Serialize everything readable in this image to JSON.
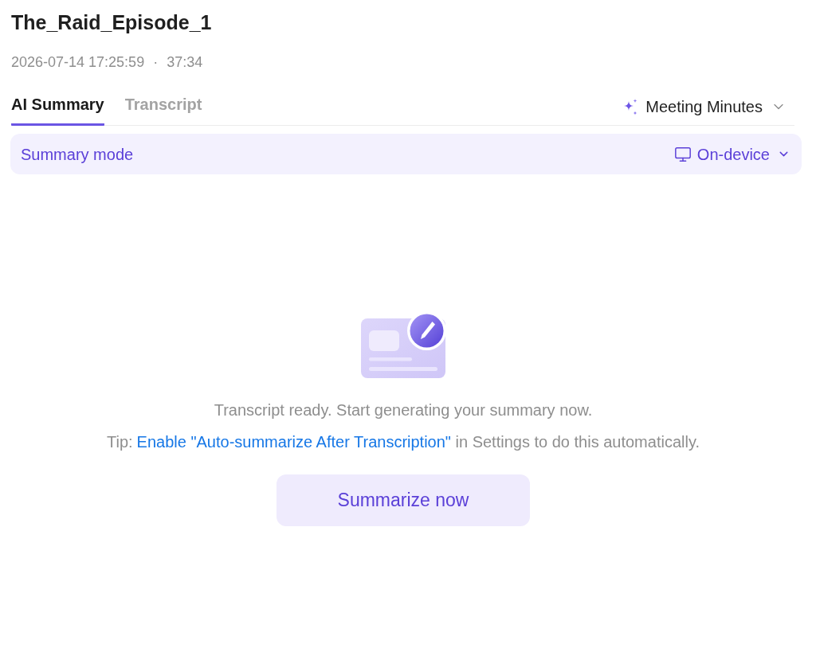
{
  "title": "The_Raid_Episode_1",
  "meta": {
    "datetime": "2026-07-14 17:25:59",
    "separator": "·",
    "duration": "37:34"
  },
  "tabs": [
    {
      "label": "AI Summary",
      "selected": true
    },
    {
      "label": "Transcript",
      "selected": false
    }
  ],
  "template_dropdown": {
    "label": "Meeting Minutes"
  },
  "summary_mode": {
    "label": "Summary mode",
    "value": "On-device"
  },
  "empty_state": {
    "message": "Transcript ready. Start generating your summary now.",
    "tip": {
      "prefix": "Tip:",
      "link": "Enable \"Auto-summarize After Transcription\"",
      "suffix": "in Settings to do this automatically."
    },
    "button": "Summarize now"
  }
}
